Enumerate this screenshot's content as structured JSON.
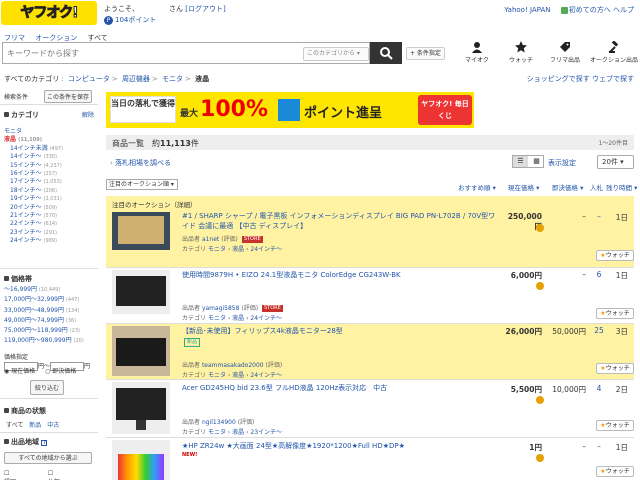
{
  "header": {
    "logo": "ヤフオク!",
    "greeting_prefix": "ようこそ、",
    "greeting_suffix": "さん",
    "logout": "[ログアウト]",
    "points": "104ポイント",
    "yahoo_japan": "Yahoo! JAPAN",
    "beginners": "初めての方へ",
    "help": "ヘルプ"
  },
  "nav_tabs": [
    "フリマ",
    "オークション",
    "すべて"
  ],
  "search": {
    "placeholder": "キーワードから探す",
    "category_select": "このカテゴリから",
    "condition_button": "+ 条件指定"
  },
  "header_icons": [
    {
      "label": "マイオク",
      "icon": "user-icon"
    },
    {
      "label": "ウォッチ",
      "icon": "star-icon"
    },
    {
      "label": "フリマ出品",
      "icon": "tag-icon"
    },
    {
      "label": "オークション出品",
      "icon": "gavel-icon"
    }
  ],
  "breadcrumb": [
    "すべてのカテゴリ",
    "コンピュータ",
    "周辺機器",
    "モニタ",
    "液晶"
  ],
  "top_links": [
    "ショッピングで探す",
    "ウェブで探す"
  ],
  "sidebar": {
    "search_conditions": "検索条件",
    "save_button": "この条件を保存",
    "category_title": "カテゴリ",
    "clear": "解除",
    "categories": [
      {
        "label": "モニタ",
        "count": "",
        "level": 0
      },
      {
        "label": "液晶",
        "count": "(11,109)",
        "level": 1
      },
      {
        "label": "14インチ未満",
        "count": "(497)",
        "level": 2
      },
      {
        "label": "14インチ〜",
        "count": "(330)",
        "level": 2
      },
      {
        "label": "15インチ〜",
        "count": "(4,237)",
        "level": 2
      },
      {
        "label": "16インチ〜",
        "count": "(257)",
        "level": 2
      },
      {
        "label": "17インチ〜",
        "count": "(1,053)",
        "level": 2
      },
      {
        "label": "18インチ〜",
        "count": "(206)",
        "level": 2
      },
      {
        "label": "19インチ〜",
        "count": "(1,031)",
        "level": 2
      },
      {
        "label": "20インチ〜",
        "count": "(509)",
        "level": 2
      },
      {
        "label": "21インチ〜",
        "count": "(570)",
        "level": 2
      },
      {
        "label": "22インチ〜",
        "count": "(614)",
        "level": 2
      },
      {
        "label": "23インチ〜",
        "count": "(291)",
        "level": 2
      },
      {
        "label": "24インチ〜",
        "count": "(989)",
        "level": 2
      }
    ],
    "price_title": "価格帯",
    "prices": [
      {
        "label": "〜16,999円",
        "count": "(10,449)"
      },
      {
        "label": "17,000円〜32,999円",
        "count": "(447)"
      },
      {
        "label": "33,000円〜48,999円",
        "count": "(134)"
      },
      {
        "label": "49,000円〜74,999円",
        "count": "(36)"
      },
      {
        "label": "75,000円〜118,999円",
        "count": "(23)"
      },
      {
        "label": "119,000円〜980,999円",
        "count": "(20)"
      }
    ],
    "price_input_label": "価格指定",
    "yen": "円〜",
    "yen2": "円",
    "radio_current": "現在価格",
    "radio_buyout": "即決価格",
    "narrow_button": "絞り込む",
    "condition_title": "商品の状態",
    "conditions": [
      "すべて",
      "新品",
      "中古"
    ],
    "region_title": "出品地域",
    "all_regions_button": "すべての地域から選ぶ",
    "regions": [
      "福岡",
      "佐賀"
    ]
  },
  "banner": {
    "left": "当日の落札で獲得",
    "max": "最大",
    "percent": "100%",
    "text": "ポイント進呈",
    "badge": "ヤフオク! 毎日くじ"
  },
  "list": {
    "title": "商品一覧",
    "approx": "約",
    "count": "11,113",
    "unit": "件",
    "range": "1〜20件目",
    "bid_link": "落札相場を調べる",
    "display_settings": "表示設定",
    "per_page": "20件",
    "sort": "注目のオークション順",
    "col_recommended": "おすすめ順",
    "col_current": "現在価格",
    "col_buyout": "即決価格",
    "col_bids": "入札",
    "col_remaining": "残り時間"
  },
  "featured_label": "注目のオークション（詳細）",
  "items": [
    {
      "title": "#1 / SHARP シャープ / 電子黒板 インフォメーションディスプレイ BIG PAD PN-L702B / 70V型ワイド 会議に最適 【中古 ディスプレイ】",
      "seller": "a1net",
      "store": "STORE",
      "category": "24インチ〜",
      "price": "250,000円",
      "buyout": "–",
      "bids": "–",
      "remaining": "1日",
      "watch": "ウォッチ",
      "highlight": true
    },
    {
      "title": "使用時間9879H • EIZO 24.1型液晶モニタ ColorEdge CG243W-BK",
      "seller": "yamagi5858",
      "store": "STORE",
      "category": "24インチ〜",
      "price": "6,000円",
      "buyout": "–",
      "bids": "6",
      "remaining": "1日",
      "watch": "ウォッチ",
      "highlight": false
    },
    {
      "title": "【新品･未使用】フィリップス4k液晶モニター28型",
      "seller": "teammasakado2000",
      "store": "",
      "category": "24インチ〜",
      "price": "26,000円",
      "buyout": "50,000円",
      "bids": "25",
      "remaining": "3日",
      "watch": "ウォッチ",
      "highlight": true,
      "badge": "新品"
    },
    {
      "title": "Acer GD245HQ bid 23.6型 フルHD液晶 120Hz表示対応　中古",
      "seller": "ngil134900",
      "store": "",
      "category": "23インチ〜",
      "price": "5,500円",
      "buyout": "10,000円",
      "bids": "4",
      "remaining": "2日",
      "watch": "ウォッチ",
      "highlight": false
    },
    {
      "title": "★HP ZR24w ★大画面 24型★高解像度★1920*1200★Full HD★DP★",
      "seller": "",
      "store": "",
      "category": "",
      "price": "1円",
      "buyout": "–",
      "bids": "–",
      "remaining": "1日",
      "watch": "ウォッチ",
      "highlight": false
    }
  ],
  "labels": {
    "seller": "出品者",
    "rating": "(評価)",
    "category": "カテゴリ",
    "sep_monitor": "モニタ",
    "sep_lcd": "液晶"
  }
}
